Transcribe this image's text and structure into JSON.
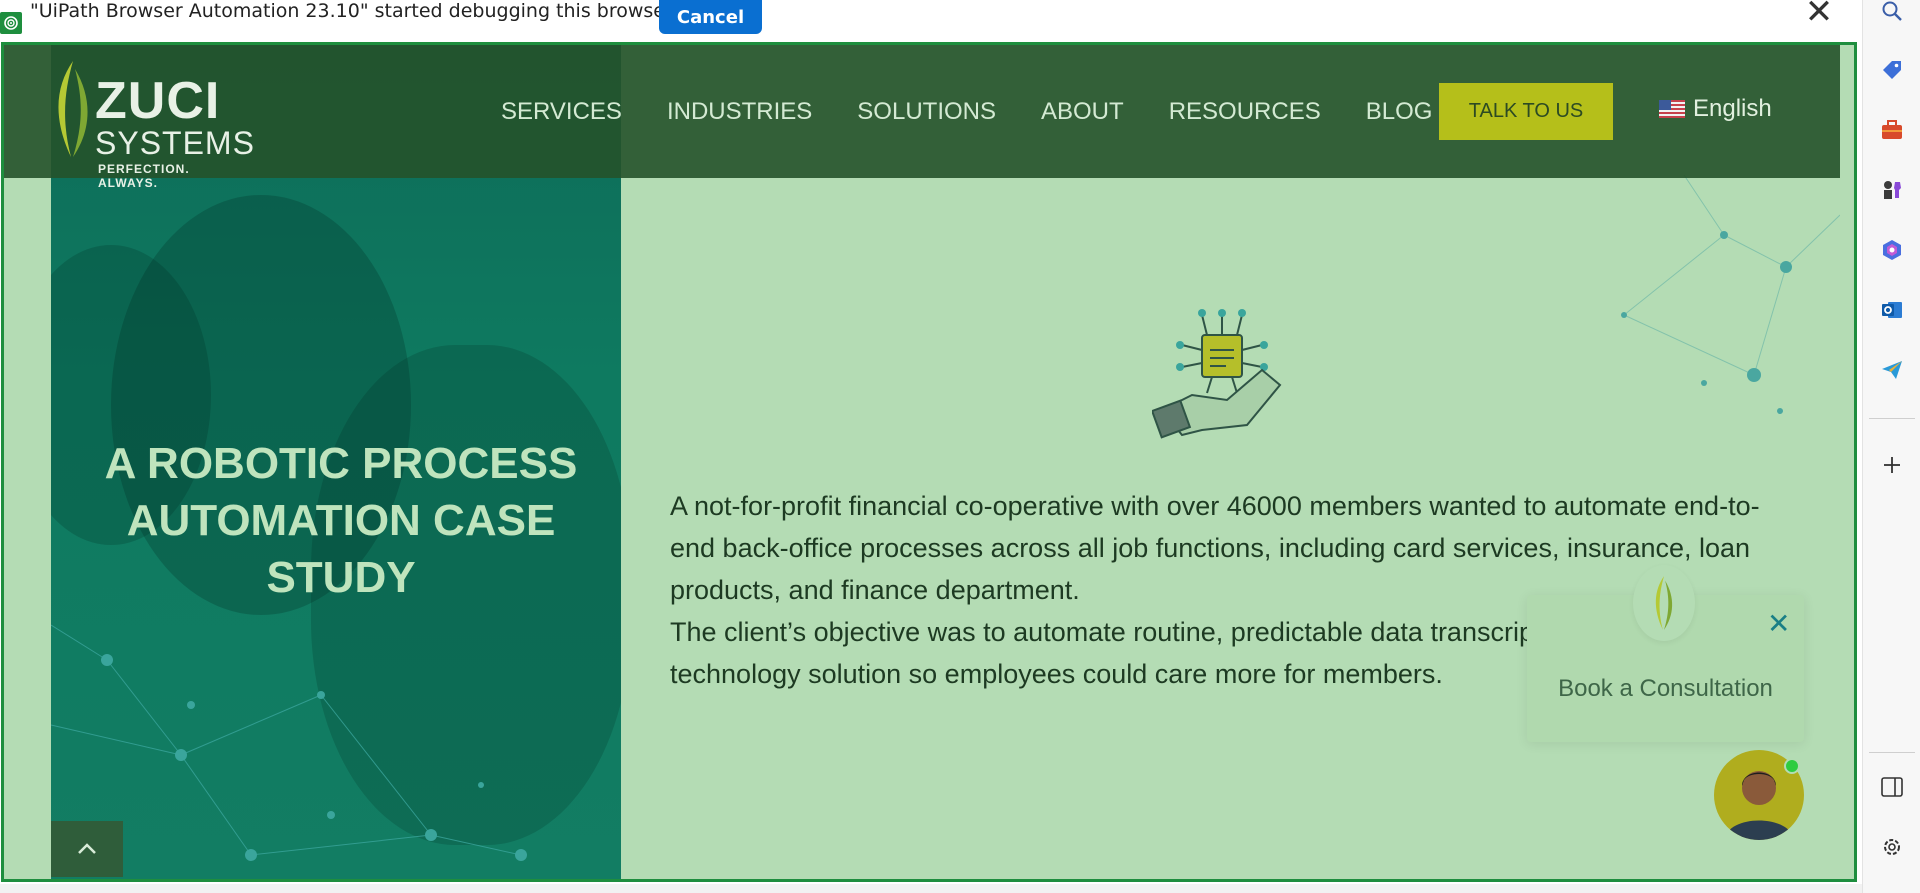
{
  "debug_bar": {
    "message": "\"UiPath Browser Automation 23.10\" started debugging this browser",
    "cancel_label": "Cancel",
    "close_label": "✕"
  },
  "nav": {
    "logo": {
      "line1": "ZUCI",
      "line2": "SYSTEMS",
      "tagline": "PERFECTION. ALWAYS."
    },
    "items": [
      "SERVICES",
      "INDUSTRIES",
      "SOLUTIONS",
      "ABOUT",
      "RESOURCES",
      "BLOG"
    ],
    "cta_label": "TALK TO US",
    "language": "English"
  },
  "hero": {
    "title_lines": [
      "A ROBOTIC PROCESS",
      "AUTOMATION CASE",
      "STUDY"
    ]
  },
  "content": {
    "paragraph1": "A not-for-profit financial co-operative with over 46000 members wanted to automate end-to-end back-office processes across all job functions, including card services, insurance, loan products, and finance department.",
    "paragraph2": "The client’s objective was to automate routine, predictable data transcript",
    "paragraph2_cont": "technology solution so employees could care more for members."
  },
  "consult_popup": {
    "label": "Book a Consultation",
    "close_label": "✕"
  },
  "scroll_top_label": "⌃",
  "colors": {
    "accent": "#b5bf1a",
    "nav_bg": "#25522a",
    "hero_bg": "#0e7a60",
    "page_bg": "#b4dcb4",
    "cancel_button": "#0a6fd1"
  },
  "sidebar_icons": [
    "search-icon",
    "tag-icon",
    "briefcase-icon",
    "chess-icon",
    "copilot-icon",
    "outlook-icon",
    "send-icon",
    "add-icon",
    "split-view-icon",
    "settings-icon"
  ]
}
